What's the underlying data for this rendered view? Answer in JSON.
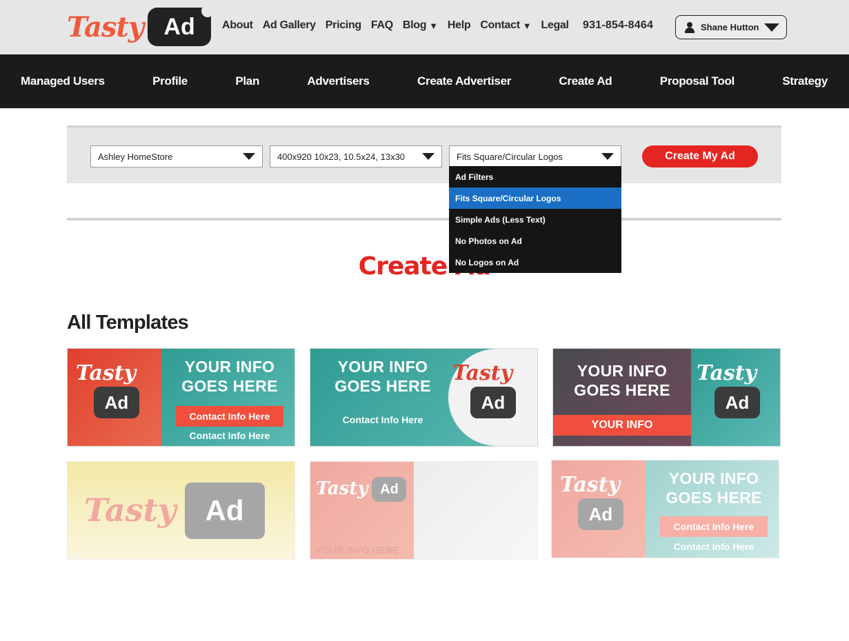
{
  "brand": {
    "tasty": "Tasty",
    "ad": "Ad"
  },
  "top_nav": {
    "items": [
      {
        "label": "About"
      },
      {
        "label": "Ad Gallery"
      },
      {
        "label": "Pricing"
      },
      {
        "label": "FAQ"
      },
      {
        "label": "Blog",
        "caret": "▼"
      },
      {
        "label": "Help"
      },
      {
        "label": "Contact",
        "caret": "▼"
      },
      {
        "label": "Legal"
      }
    ],
    "phone": "931-854-8464",
    "user": "Shane Hutton"
  },
  "main_nav": [
    "Managed Users",
    "Profile",
    "Plan",
    "Advertisers",
    "Create Advertiser",
    "Create Ad",
    "Proposal Tool",
    "Strategy"
  ],
  "filters": {
    "advertiser": "Ashley HomeStore",
    "size": "400x920 10x23, 10.5x24, 13x30",
    "filter": "Fits Square/Circular Logos",
    "create_button": "Create My Ad"
  },
  "dropdown": {
    "options": [
      "Ad Filters",
      "Fits Square/Circular Logos",
      "Simple Ads (Less Text)",
      "No Photos on Ad",
      "No Logos on Ad"
    ],
    "selected": "Fits Square/Circular Logos"
  },
  "page_title": "Create Ad",
  "section_title": "All Templates",
  "templates": {
    "headline_line1": "YOUR INFO",
    "headline_line2": "GOES HERE",
    "contact": "Contact Info Here",
    "your_info": "YOUR INFO",
    "your_info_here": "YOUR INFO HERE"
  },
  "colors": {
    "accent_red": "#e52521",
    "template_red": "#e0402e",
    "template_teal": "#2f9c94",
    "dropdown_selected": "#1a6fc4",
    "nav_bg": "#1b1b1b"
  }
}
